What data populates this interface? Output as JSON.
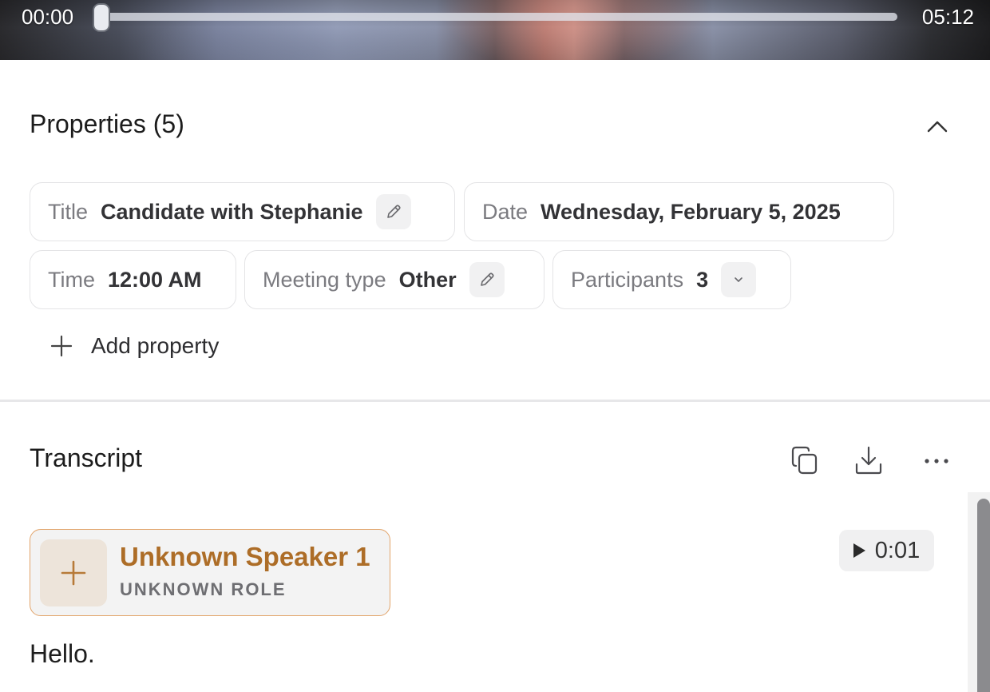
{
  "video": {
    "current_time": "00:00",
    "duration": "05:12",
    "progress": 0.0
  },
  "properties": {
    "title": "Properties (5)",
    "chips": {
      "title": {
        "key": "Title",
        "value": "Candidate with Stephanie",
        "icon": "pencil-icon"
      },
      "date": {
        "key": "Date",
        "value": "Wednesday, February 5, 2025"
      },
      "time": {
        "key": "Time",
        "value": "12:00 AM"
      },
      "meeting_type": {
        "key": "Meeting type",
        "value": "Other",
        "icon": "pencil-icon"
      },
      "participants": {
        "key": "Participants",
        "value": "3",
        "icon": "chevron-down-icon"
      }
    },
    "add_property_label": "Add property",
    "collapse_icon": "chevron-up-icon"
  },
  "transcript": {
    "title": "Transcript",
    "toolbar_icons": [
      "copy-icon",
      "download-icon",
      "more-icon"
    ],
    "entries": [
      {
        "speaker": "Unknown Speaker 1",
        "role": "UNKNOWN ROLE",
        "timestamp": "0:01",
        "text": "Hello."
      }
    ]
  },
  "colors": {
    "speaker_accent": "#ad6d27",
    "speaker_border": "#e2a46a",
    "chip_border": "#e4e4e6"
  }
}
